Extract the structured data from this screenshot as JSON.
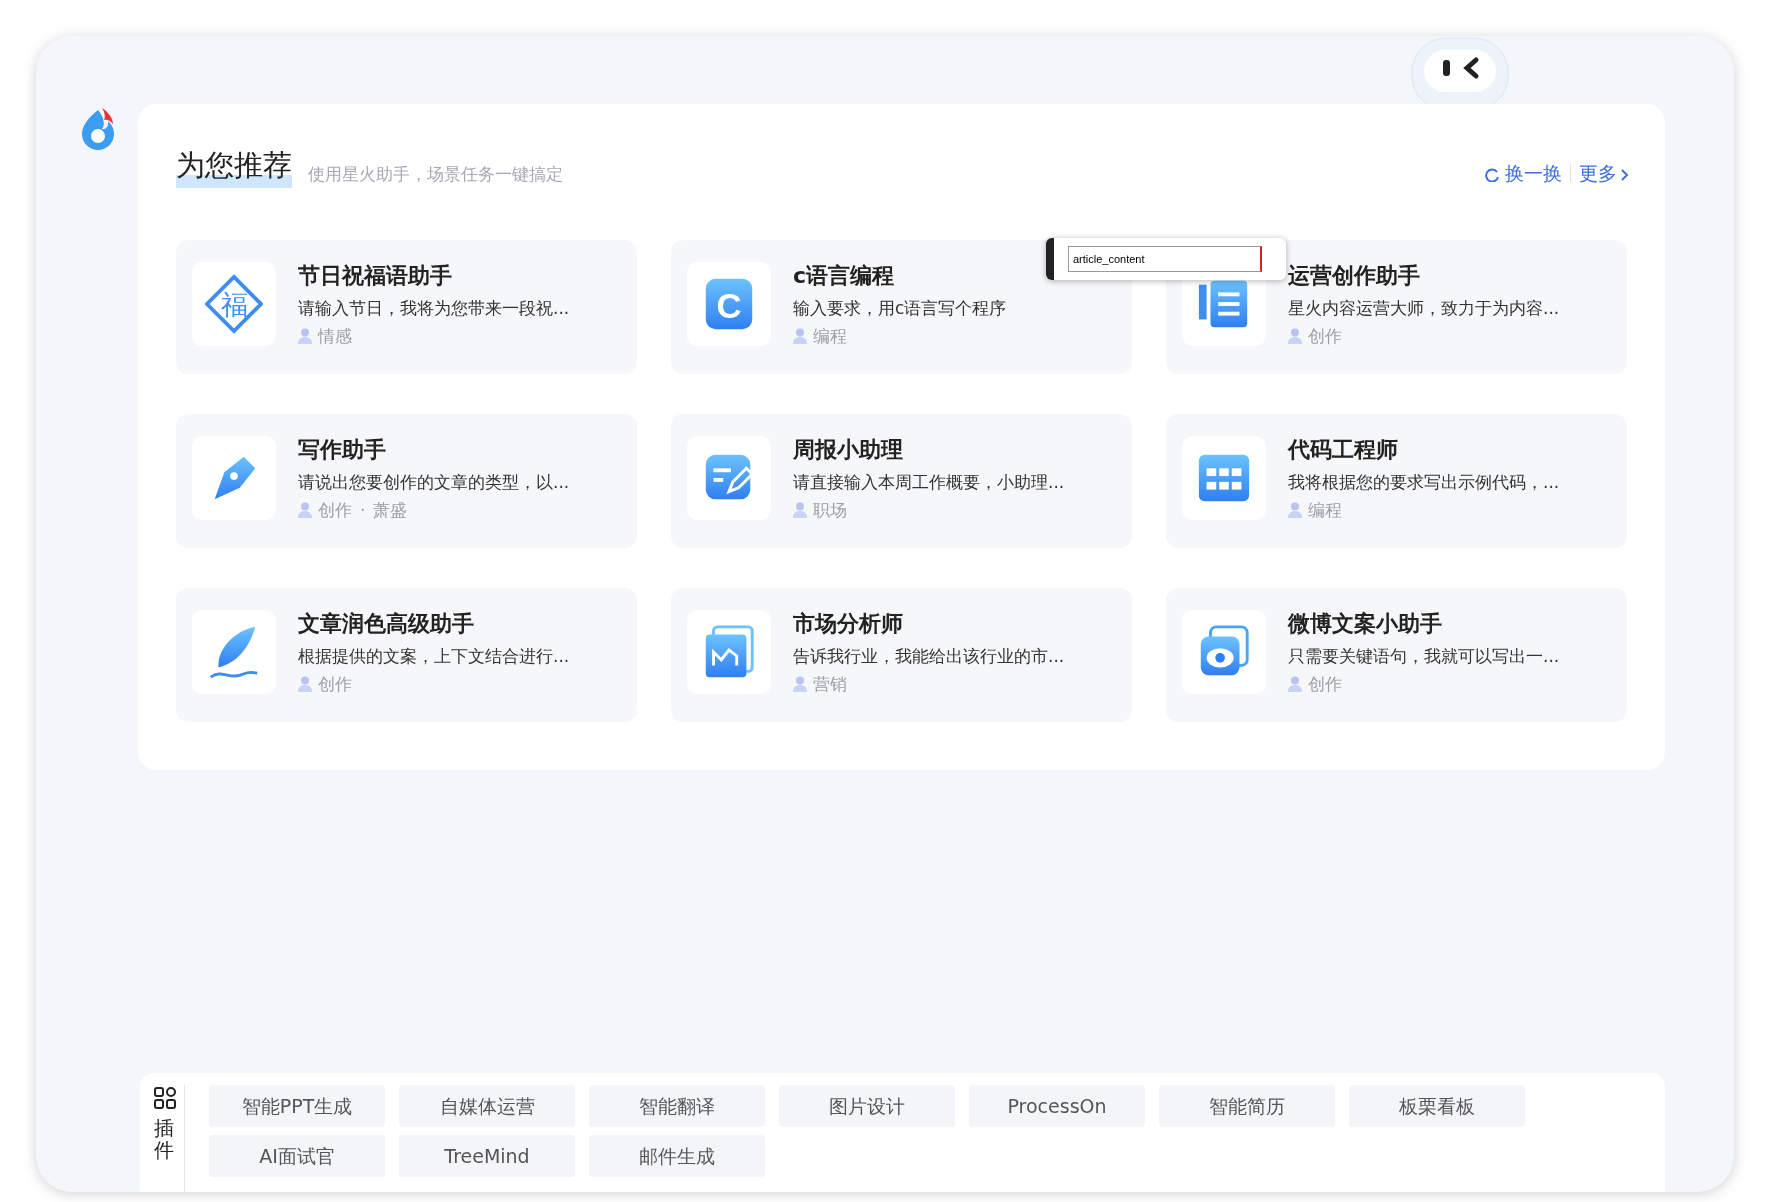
{
  "header": {
    "title": "为您推荐",
    "subtitle": "使用星火助手，场景任务一键搞定",
    "refresh": "换一换",
    "more": "更多"
  },
  "cards": [
    {
      "kind": "glyph_diamond",
      "glyph": "福",
      "title": "节日祝福语助手",
      "desc": "请输入节日，我将为您带来一段祝...",
      "tags": [
        "情感"
      ]
    },
    {
      "kind": "glyph_square",
      "glyph": "C",
      "title": "c语言编程",
      "desc": "输入要求，用c语言写个程序",
      "tags": [
        "编程"
      ]
    },
    {
      "kind": "doc",
      "title": "运营创作助手",
      "desc": "星火内容运营大师，致力于为内容...",
      "tags": [
        "创作"
      ]
    },
    {
      "kind": "pen",
      "title": "写作助手",
      "desc": "请说出您要创作的文章的类型，以...",
      "tags": [
        "创作",
        "·",
        "萧盛"
      ]
    },
    {
      "kind": "edit",
      "title": "周报小助理",
      "desc": "请直接输入本周工作概要，小助理...",
      "tags": [
        "职场"
      ]
    },
    {
      "kind": "grid",
      "title": "代码工程师",
      "desc": "我将根据您的要求写出示例代码，...",
      "tags": [
        "编程"
      ]
    },
    {
      "kind": "feather",
      "title": "文章润色高级助手",
      "desc": "根据提供的文案，上下文结合进行...",
      "tags": [
        "创作"
      ]
    },
    {
      "kind": "chart",
      "title": "市场分析师",
      "desc": "告诉我行业，我能给出该行业的市...",
      "tags": [
        "营销"
      ]
    },
    {
      "kind": "eye",
      "title": "微博文案小助手",
      "desc": "只需要关键语句，我就可以写出一...",
      "tags": [
        "创作"
      ]
    }
  ],
  "overlay_input": {
    "value": "article_content"
  },
  "plugins": {
    "label": "插件",
    "items": [
      "智能PPT生成",
      "自媒体运营",
      "智能翻译",
      "图片设计",
      "ProcessOn",
      "智能简历",
      "板栗看板",
      "AI面试官",
      "TreeMind",
      "邮件生成"
    ]
  }
}
